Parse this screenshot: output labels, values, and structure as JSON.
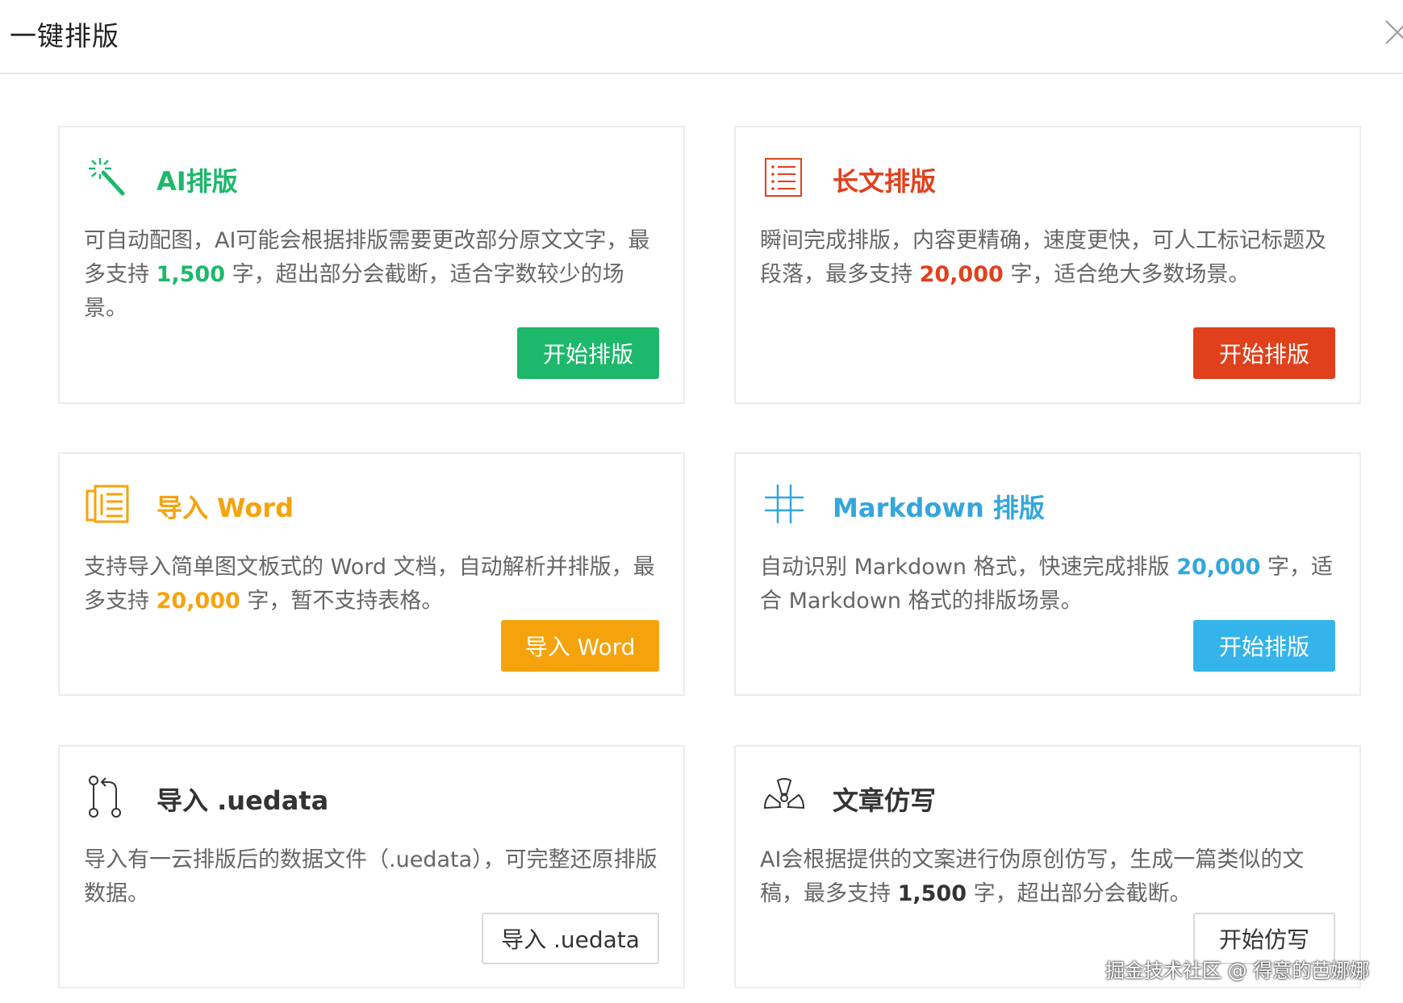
{
  "dialog": {
    "title": "一键排版"
  },
  "colors": {
    "green": "#1db86b",
    "red": "#e0401c",
    "orange": "#f5a30c",
    "blue": "#34a6dc",
    "dark": "#333333"
  },
  "cards": [
    {
      "id": "ai",
      "icon": "magic-wand-icon",
      "title": "AI排版",
      "desc_pre": "可自动配图，AI可能会根据排版需要更改部分原文文字，最多支持 ",
      "highlight": "1,500",
      "desc_post": " 字，超出部分会截断，适合字数较少的场景。",
      "button": "开始排版"
    },
    {
      "id": "long",
      "icon": "list-document-icon",
      "title": "长文排版",
      "desc_pre": "瞬间完成排版，内容更精确，速度更快，可人工标记标题及段落，最多支持 ",
      "highlight": "20,000",
      "desc_post": " 字，适合绝大多数场景。",
      "button": "开始排版"
    },
    {
      "id": "word",
      "icon": "word-document-icon",
      "title": "导入 Word",
      "desc_pre": "支持导入简单图文板式的 Word 文档，自动解析并排版，最多支持 ",
      "highlight": "20,000",
      "desc_post": " 字，暂不支持表格。",
      "button": "导入 Word"
    },
    {
      "id": "markdown",
      "icon": "hash-icon",
      "title": "Markdown 排版",
      "desc_pre": "自动识别 Markdown 格式，快速完成排版 ",
      "highlight": "20,000",
      "desc_post": " 字，适合 Markdown 格式的排版场景。",
      "button": "开始排版"
    },
    {
      "id": "uedata",
      "icon": "git-branch-icon",
      "title": "导入 .uedata",
      "desc_pre": "导入有一云排版后的数据文件（.uedata），可完整还原排版数据。",
      "highlight": "",
      "desc_post": "",
      "button": "导入 .uedata"
    },
    {
      "id": "rewrite",
      "icon": "radiation-icon",
      "title": "文章仿写",
      "desc_pre": "AI会根据提供的文案进行伪原创仿写，生成一篇类似的文稿，最多支持 ",
      "highlight": "1,500",
      "desc_post": " 字，超出部分会截断。",
      "button": "开始仿写"
    }
  ],
  "watermark": "掘金技术社区 @ 得意的芭娜娜"
}
